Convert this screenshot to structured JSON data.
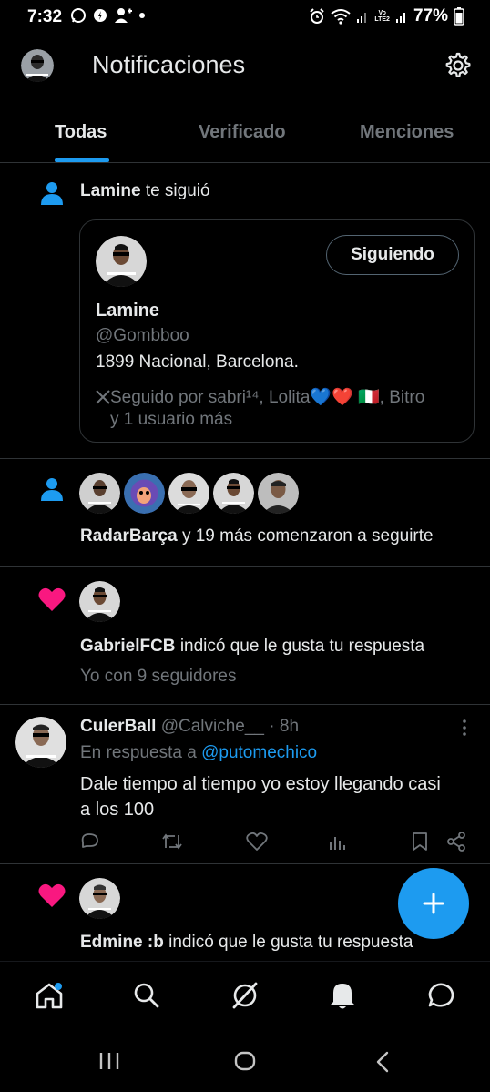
{
  "status_bar": {
    "time": "7:32",
    "battery": "77%",
    "network_top": "Vo",
    "network_bottom": "LTE2"
  },
  "header": {
    "title": "Notificaciones"
  },
  "tabs": [
    {
      "label": "Todas",
      "active": true
    },
    {
      "label": "Verificado",
      "active": false
    },
    {
      "label": "Menciones",
      "active": false
    }
  ],
  "notifications": {
    "follow": {
      "name": "Lamine",
      "action": "te siguió",
      "card": {
        "display_name": "Lamine",
        "handle": "@Gombboo",
        "bio": "1899 Nacional, Barcelona.",
        "button": "Siguiendo",
        "followed_by_line1": "Seguido por sabri¹⁴, Lolita💙❤️ 🇮🇹, Bitro",
        "followed_by_line2": "y 1 usuario más"
      }
    },
    "multi_follow": {
      "name": "RadarBarça",
      "action": "y 19 más comenzaron a seguirte"
    },
    "like1": {
      "name": "GabrielFCB",
      "action": "indicó que le gusta tu respuesta",
      "quote": "Yo con 9 seguidores"
    },
    "reply": {
      "name": "CulerBall",
      "handle": "@Calviche__",
      "time": "· 8h",
      "reply_prefix": "En respuesta a",
      "reply_to": "@putomechico",
      "text_line1": "Dale tiempo al tiempo yo estoy llegando casi",
      "text_line2": "a los 100"
    },
    "like2": {
      "name": "Edmine :b",
      "action": "indicó que le gusta tu respuesta"
    }
  },
  "colors": {
    "accent": "#1d9bf0",
    "like": "#f91880",
    "muted": "#71767b",
    "divider": "#2f3336"
  }
}
